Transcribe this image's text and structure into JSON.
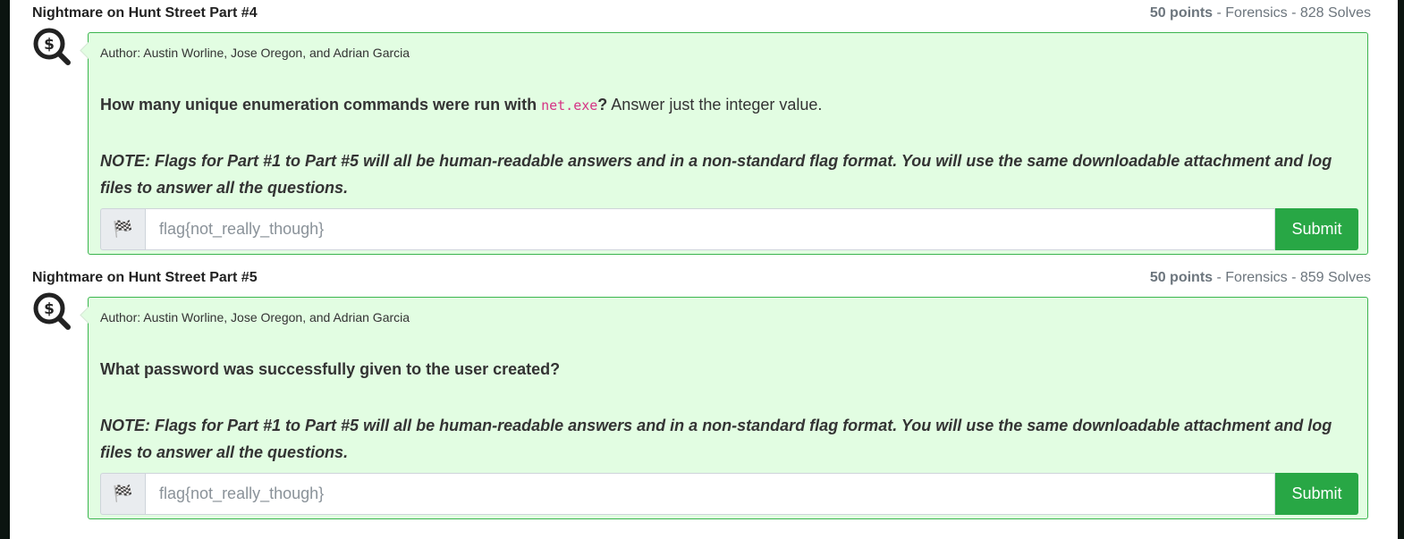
{
  "challenges": [
    {
      "title": "Nightmare on Hunt Street Part #4",
      "points": "50 points",
      "meta_rest": " - Forensics - 828 Solves",
      "author": "Author: Austin Worline, Jose Oregon, and Adrian Garcia",
      "question_bold_1": "How many unique enumeration commands were run with ",
      "question_code": "net.exe",
      "question_bold_2": "?",
      "question_rest": " Answer just the integer value.",
      "note": "NOTE: Flags for Part #1 to Part #5 will all be human-readable answers and in a non-standard flag format. You will use the same downloadable attachment and log files to answer all the questions.",
      "flag_placeholder": "flag{not_really_though}",
      "submit_label": "Submit",
      "icon": "search-dollar-icon"
    },
    {
      "title": "Nightmare on Hunt Street Part #5",
      "points": "50 points",
      "meta_rest": " - Forensics - 859 Solves",
      "author": "Author: Austin Worline, Jose Oregon, and Adrian Garcia",
      "question_bold_1": "What password was successfully given to the user created?",
      "question_code": "",
      "question_bold_2": "",
      "question_rest": "",
      "note": "NOTE: Flags for Part #1 to Part #5 will all be human-readable answers and in a non-standard flag format. You will use the same downloadable attachment and log files to answer all the questions.",
      "flag_placeholder": "flag{not_really_though}",
      "submit_label": "Submit",
      "icon": "search-dollar-icon"
    }
  ],
  "flag_addon_icon": "checkered-flag-icon",
  "colors": {
    "card_bg": "#e2fde2",
    "card_border": "#3bb54e",
    "submit_bg": "#28a745",
    "code_color": "#d63384"
  }
}
